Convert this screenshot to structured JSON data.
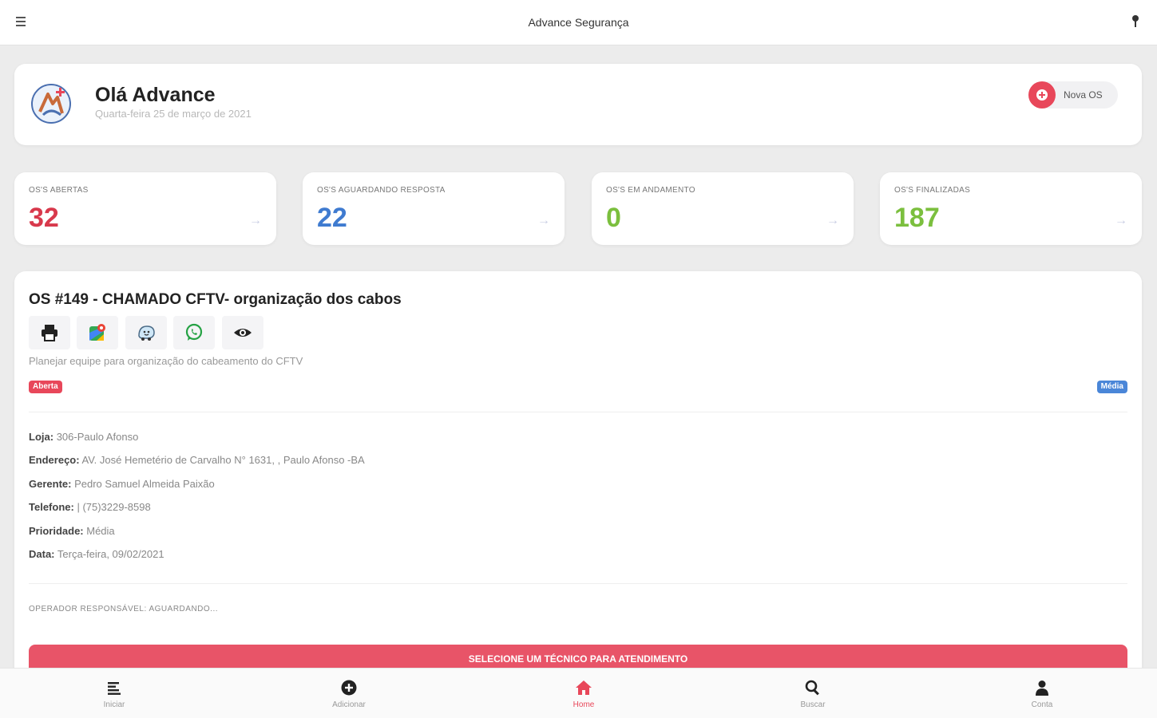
{
  "app": {
    "title": "Advance Segurança"
  },
  "greeting": {
    "title": "Olá Advance",
    "date": "Quarta-feira 25 de março de 2021"
  },
  "new_os": {
    "label": "Nova OS"
  },
  "stats": [
    {
      "label": "OS'S ABERTAS",
      "value": "32",
      "color": "#d8394c"
    },
    {
      "label": "OS'S AGUARDANDO RESPOSTA",
      "value": "22",
      "color": "#3f7bd0"
    },
    {
      "label": "OS'S EM ANDAMENTO",
      "value": "0",
      "color": "#7bbf3e"
    },
    {
      "label": "OS'S FINALIZADAS",
      "value": "187",
      "color": "#7bbf3e"
    }
  ],
  "order": {
    "title": "OS #149 - CHAMADO CFTV- organização dos cabos",
    "tools": [
      "print-icon",
      "maps-icon",
      "waze-icon",
      "whatsapp-icon",
      "eye-icon"
    ],
    "description": "Planejar equipe para organização do cabeamento do CFTV",
    "status": "Aberta",
    "priority_badge": "Média",
    "details": [
      {
        "label": "Loja:",
        "value": "306-Paulo Afonso"
      },
      {
        "label": "Endereço:",
        "value": "AV. José Hemetério de Carvalho N° 1631, , Paulo Afonso -BA"
      },
      {
        "label": "Gerente:",
        "value": "Pedro Samuel Almeida Paixão"
      },
      {
        "label": "Telefone:",
        "value": "| (75)3229-8598"
      },
      {
        "label": "Prioridade:",
        "value": "Média"
      },
      {
        "label": "Data:",
        "value": "Terça-feira, 09/02/2021"
      }
    ],
    "operator": "OPERADOR RESPONSÁVEL: AGUARDANDO...",
    "select_button": "SELECIONE UM TÉCNICO PARA ATENDIMENTO"
  },
  "bottom_nav": [
    {
      "label": "Iniciar",
      "icon": "list-icon"
    },
    {
      "label": "Adicionar",
      "icon": "plus-circle-icon"
    },
    {
      "label": "Home",
      "icon": "home-icon",
      "active": true
    },
    {
      "label": "Buscar",
      "icon": "search-icon"
    },
    {
      "label": "Conta",
      "icon": "user-icon"
    }
  ],
  "colors": {
    "accent": "#e8475a",
    "blue": "#4a86d8",
    "green": "#7bbf3e"
  }
}
